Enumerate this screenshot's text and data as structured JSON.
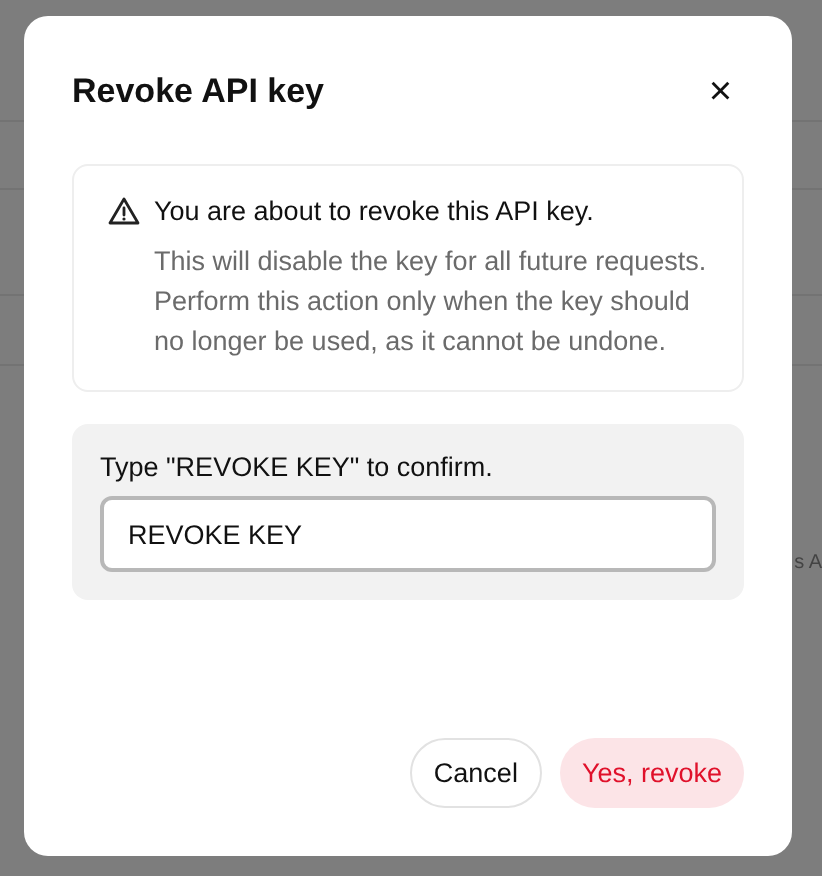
{
  "background": {
    "text_fragment": "s A"
  },
  "dialog": {
    "title": "Revoke API key",
    "close": "×",
    "alert": {
      "heading": "You are about to revoke this API key.",
      "body": "This will disable the key for all future requests. Perform this action only when the key should no longer be used, as it cannot be undone."
    },
    "confirm": {
      "label": "Type \"REVOKE KEY\" to confirm.",
      "value": "REVOKE KEY"
    },
    "buttons": [
      {
        "label": "Cancel",
        "kind": "secondary"
      },
      {
        "label": "Yes, revoke",
        "kind": "danger"
      }
    ]
  }
}
